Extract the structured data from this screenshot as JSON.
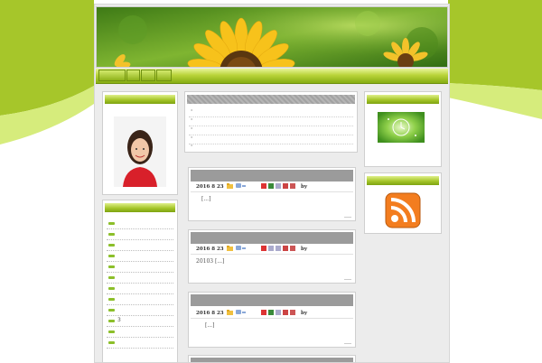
{
  "colors": {
    "accent_green": "#9fc223",
    "dark_green": "#6f9110",
    "bar_grey": "#9b9b9b",
    "page_bg": "#ececec"
  },
  "nav": {
    "items": [
      "",
      "",
      "",
      ""
    ]
  },
  "recent_list": {
    "items": [
      "°",
      "°",
      "°",
      "°",
      "°"
    ]
  },
  "posts": [
    {
      "date": "2016 8 23",
      "by": "by",
      "excerpt": "[...]"
    },
    {
      "date": "2016 8 23",
      "by": "by",
      "excerpt": "20103  [...]"
    },
    {
      "date": "2016 8 23",
      "by": "by",
      "excerpt": "[...]"
    }
  ],
  "sidebar_left": {
    "items": [
      "",
      "",
      "",
      "",
      "",
      "",
      "",
      "",
      "",
      "3",
      "",
      ""
    ]
  },
  "icons": {
    "profile": "profile-photo",
    "clock": "clock-icon",
    "rss": "rss-icon",
    "folder": "folder-icon",
    "comment": "comment-icon"
  }
}
